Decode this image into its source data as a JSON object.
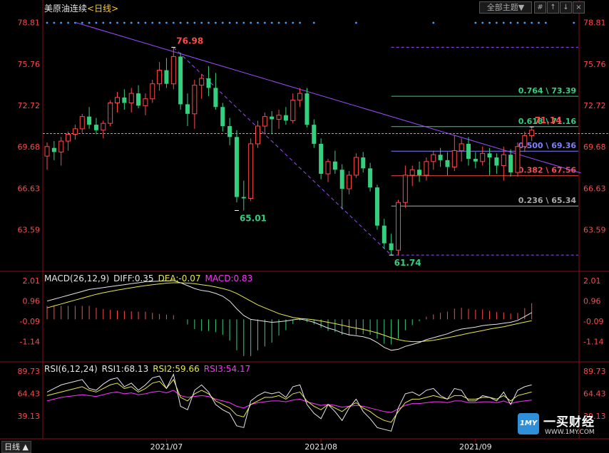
{
  "header": {
    "instrument": "美原油连续",
    "period_label": "<日线>",
    "theme_button": "全部主题▼",
    "tool_buttons": [
      "#",
      "↑",
      "↓",
      "×"
    ]
  },
  "period_tab": "日线 ▲",
  "macd_title": {
    "name": "MACD(26,12,9)",
    "diff": "DIFF:0.35",
    "dea": "DEA:-0.07",
    "macd": "MACD:0.83"
  },
  "rsi_title": {
    "name": "RSI(6,12,24)",
    "rsi1": "RSI1:68.13",
    "rsi2": "RSI2:59.66",
    "rsi3": "RSI3:54.17"
  },
  "logo": {
    "badge": "1MY",
    "name": "一买财经",
    "url": "WWW.1MY.COM"
  },
  "colors": {
    "up": "#ff4a4a",
    "down": "#35d07f",
    "trend_line": "#9b4dff",
    "diff_line": "#e6e6e6",
    "dea_line": "#e8e84a",
    "rsi3_line": "#ff33ff",
    "price_line": "#ff9900"
  },
  "chart_data": {
    "type": "candlestick",
    "y_ticks_main": [
      "78.81",
      "75.76",
      "72.72",
      "69.68",
      "66.63",
      "63.59"
    ],
    "y_range_main": [
      60.7,
      79.3
    ],
    "y_ticks_macd": [
      "2.01",
      "0.96",
      "-0.09",
      "-1.14"
    ],
    "y_range_macd": [
      -2.2,
      2.6
    ],
    "y_ticks_rsi": [
      "89.73",
      "64.43",
      "39.13"
    ],
    "y_range_rsi": [
      15,
      100
    ],
    "x_labels": [
      {
        "label": "2021/07",
        "index": 17
      },
      {
        "label": "2021/08",
        "index": 39
      },
      {
        "label": "2021/09",
        "index": 61
      }
    ],
    "current_price": 70.65,
    "annotations": [
      {
        "label": "76.98",
        "index": 18,
        "value": 76.98,
        "position": "above"
      },
      {
        "label": "65.01",
        "index": 27,
        "value": 65.01,
        "position": "below"
      },
      {
        "label": "61.74",
        "index": 49,
        "value": 61.74,
        "position": "below"
      },
      {
        "label": "71.14",
        "index": 69,
        "value": 71.14,
        "position": "above"
      }
    ],
    "fibonacci": {
      "start_index": 49,
      "levels": [
        {
          "label": "",
          "value": 76.98,
          "color": "#9b4dff",
          "dash": true
        },
        {
          "label": "0.764 \\ 73.39",
          "value": 73.39,
          "color": "#35d07f"
        },
        {
          "label": "0.618 \\ 71.16",
          "value": 71.16,
          "color": "#35d07f"
        },
        {
          "label": "0.500 \\ 69.36",
          "value": 69.36,
          "color": "#8080ff"
        },
        {
          "label": "0.382 \\ 67.56",
          "value": 67.56,
          "color": "#ff4a4a"
        },
        {
          "label": "0.236 \\ 65.34",
          "value": 65.34,
          "color": "#aaaaaa"
        },
        {
          "label": "",
          "value": 61.74,
          "color": "#9b4dff",
          "dash": true
        }
      ]
    },
    "trend_lines": [
      {
        "from": [
          4,
          78.81
        ],
        "to": [
          76,
          67.76
        ],
        "dash": false
      },
      {
        "from": [
          18,
          76.98
        ],
        "to": [
          49,
          61.74
        ],
        "dash": true
      }
    ],
    "dots_row": [
      0,
      1,
      2,
      3,
      4,
      5,
      6,
      7,
      8,
      9,
      10,
      11,
      12,
      13,
      14,
      15,
      16,
      17,
      18,
      19,
      20,
      21,
      22,
      23,
      24,
      25,
      26,
      27,
      28,
      29,
      30,
      31,
      32,
      33,
      34,
      35,
      36,
      38,
      44,
      55,
      61,
      62,
      63,
      64,
      65,
      66,
      67,
      68,
      69,
      70,
      71,
      75
    ],
    "candles": [
      {
        "o": 69.0,
        "h": 70.0,
        "l": 68.0,
        "c": 69.7
      },
      {
        "o": 69.6,
        "h": 70.1,
        "l": 68.7,
        "c": 69.3
      },
      {
        "o": 69.3,
        "h": 70.4,
        "l": 68.3,
        "c": 70.1
      },
      {
        "o": 70.1,
        "h": 70.8,
        "l": 69.4,
        "c": 70.6
      },
      {
        "o": 70.6,
        "h": 71.3,
        "l": 70.2,
        "c": 71.0
      },
      {
        "o": 71.0,
        "h": 72.1,
        "l": 70.7,
        "c": 71.9
      },
      {
        "o": 71.9,
        "h": 72.6,
        "l": 71.0,
        "c": 71.3
      },
      {
        "o": 71.3,
        "h": 71.8,
        "l": 70.6,
        "c": 70.9
      },
      {
        "o": 70.9,
        "h": 71.6,
        "l": 70.3,
        "c": 71.4
      },
      {
        "o": 71.4,
        "h": 73.1,
        "l": 71.2,
        "c": 72.9
      },
      {
        "o": 72.9,
        "h": 73.7,
        "l": 72.2,
        "c": 73.3
      },
      {
        "o": 73.3,
        "h": 73.9,
        "l": 72.4,
        "c": 72.9
      },
      {
        "o": 72.9,
        "h": 74.0,
        "l": 72.2,
        "c": 73.6
      },
      {
        "o": 73.6,
        "h": 74.2,
        "l": 72.5,
        "c": 72.7
      },
      {
        "o": 72.7,
        "h": 73.6,
        "l": 72.0,
        "c": 73.2
      },
      {
        "o": 73.2,
        "h": 74.6,
        "l": 72.9,
        "c": 74.3
      },
      {
        "o": 74.3,
        "h": 75.9,
        "l": 73.8,
        "c": 75.3
      },
      {
        "o": 75.3,
        "h": 76.2,
        "l": 74.0,
        "c": 74.3
      },
      {
        "o": 74.3,
        "h": 76.98,
        "l": 73.9,
        "c": 76.3
      },
      {
        "o": 76.3,
        "h": 76.6,
        "l": 72.4,
        "c": 72.8
      },
      {
        "o": 72.8,
        "h": 73.6,
        "l": 71.2,
        "c": 72.1
      },
      {
        "o": 72.1,
        "h": 74.6,
        "l": 71.0,
        "c": 74.2
      },
      {
        "o": 74.2,
        "h": 75.0,
        "l": 73.2,
        "c": 74.7
      },
      {
        "o": 74.7,
        "h": 75.6,
        "l": 73.4,
        "c": 74.0
      },
      {
        "o": 74.0,
        "h": 75.1,
        "l": 72.4,
        "c": 72.6
      },
      {
        "o": 72.6,
        "h": 72.9,
        "l": 70.8,
        "c": 71.2
      },
      {
        "o": 71.2,
        "h": 71.8,
        "l": 69.8,
        "c": 70.4
      },
      {
        "o": 70.4,
        "h": 70.9,
        "l": 65.6,
        "c": 66.0
      },
      {
        "o": 66.0,
        "h": 67.2,
        "l": 65.01,
        "c": 65.9
      },
      {
        "o": 65.9,
        "h": 70.3,
        "l": 65.7,
        "c": 69.9
      },
      {
        "o": 69.9,
        "h": 71.6,
        "l": 69.6,
        "c": 71.2
      },
      {
        "o": 71.2,
        "h": 72.2,
        "l": 70.6,
        "c": 71.9
      },
      {
        "o": 71.9,
        "h": 72.3,
        "l": 70.6,
        "c": 71.7
      },
      {
        "o": 71.7,
        "h": 72.4,
        "l": 71.0,
        "c": 72.0
      },
      {
        "o": 72.0,
        "h": 72.6,
        "l": 71.3,
        "c": 71.6
      },
      {
        "o": 71.6,
        "h": 73.6,
        "l": 71.4,
        "c": 73.1
      },
      {
        "o": 73.1,
        "h": 74.0,
        "l": 72.6,
        "c": 73.6
      },
      {
        "o": 73.6,
        "h": 74.0,
        "l": 71.1,
        "c": 71.3
      },
      {
        "o": 71.3,
        "h": 71.7,
        "l": 69.6,
        "c": 69.9
      },
      {
        "o": 69.9,
        "h": 70.3,
        "l": 67.3,
        "c": 67.7
      },
      {
        "o": 67.7,
        "h": 68.8,
        "l": 67.1,
        "c": 68.6
      },
      {
        "o": 68.6,
        "h": 69.4,
        "l": 67.7,
        "c": 68.0
      },
      {
        "o": 68.0,
        "h": 68.4,
        "l": 65.1,
        "c": 66.6
      },
      {
        "o": 66.6,
        "h": 67.9,
        "l": 66.2,
        "c": 67.6
      },
      {
        "o": 67.6,
        "h": 69.2,
        "l": 67.4,
        "c": 68.9
      },
      {
        "o": 68.9,
        "h": 69.3,
        "l": 67.8,
        "c": 68.1
      },
      {
        "o": 68.1,
        "h": 68.5,
        "l": 66.4,
        "c": 66.7
      },
      {
        "o": 66.7,
        "h": 66.9,
        "l": 63.6,
        "c": 63.9
      },
      {
        "o": 63.9,
        "h": 64.4,
        "l": 62.2,
        "c": 62.6
      },
      {
        "o": 62.6,
        "h": 63.3,
        "l": 61.74,
        "c": 62.1
      },
      {
        "o": 62.1,
        "h": 65.8,
        "l": 61.74,
        "c": 65.6
      },
      {
        "o": 65.6,
        "h": 68.3,
        "l": 65.2,
        "c": 67.6
      },
      {
        "o": 67.6,
        "h": 68.3,
        "l": 66.8,
        "c": 68.0
      },
      {
        "o": 68.0,
        "h": 68.6,
        "l": 67.1,
        "c": 67.6
      },
      {
        "o": 67.6,
        "h": 68.9,
        "l": 67.2,
        "c": 68.6
      },
      {
        "o": 68.6,
        "h": 69.4,
        "l": 68.0,
        "c": 69.1
      },
      {
        "o": 69.1,
        "h": 69.6,
        "l": 68.2,
        "c": 68.7
      },
      {
        "o": 68.7,
        "h": 69.3,
        "l": 67.6,
        "c": 68.2
      },
      {
        "o": 68.2,
        "h": 70.5,
        "l": 67.9,
        "c": 69.4
      },
      {
        "o": 69.4,
        "h": 70.3,
        "l": 68.6,
        "c": 69.9
      },
      {
        "o": 69.9,
        "h": 70.4,
        "l": 68.3,
        "c": 68.8
      },
      {
        "o": 68.8,
        "h": 69.3,
        "l": 68.1,
        "c": 68.6
      },
      {
        "o": 68.6,
        "h": 69.7,
        "l": 68.3,
        "c": 69.2
      },
      {
        "o": 69.2,
        "h": 69.6,
        "l": 67.6,
        "c": 68.9
      },
      {
        "o": 68.9,
        "h": 69.2,
        "l": 67.7,
        "c": 68.3
      },
      {
        "o": 68.3,
        "h": 69.7,
        "l": 67.2,
        "c": 69.1
      },
      {
        "o": 69.1,
        "h": 69.5,
        "l": 67.5,
        "c": 67.8
      },
      {
        "o": 67.8,
        "h": 70.0,
        "l": 67.5,
        "c": 69.7
      },
      {
        "o": 69.7,
        "h": 70.8,
        "l": 69.3,
        "c": 70.5
      },
      {
        "o": 70.5,
        "h": 71.14,
        "l": 70.1,
        "c": 70.9
      }
    ],
    "macd": {
      "diff": [
        0.95,
        1.05,
        1.15,
        1.25,
        1.35,
        1.45,
        1.55,
        1.6,
        1.65,
        1.7,
        1.75,
        1.8,
        1.85,
        1.9,
        1.95,
        1.97,
        1.98,
        2.0,
        2.01,
        1.9,
        1.75,
        1.6,
        1.5,
        1.45,
        1.35,
        1.2,
        0.95,
        0.55,
        0.2,
        0.0,
        -0.05,
        -0.1,
        -0.15,
        -0.12,
        -0.08,
        -0.02,
        0.02,
        -0.05,
        -0.15,
        -0.3,
        -0.45,
        -0.55,
        -0.7,
        -0.8,
        -0.85,
        -0.9,
        -1.0,
        -1.2,
        -1.45,
        -1.6,
        -1.55,
        -1.4,
        -1.3,
        -1.2,
        -1.05,
        -0.95,
        -0.85,
        -0.75,
        -0.6,
        -0.5,
        -0.45,
        -0.4,
        -0.32,
        -0.28,
        -0.25,
        -0.2,
        -0.15,
        -0.05,
        0.15,
        0.35
      ],
      "dea": [
        0.6,
        0.7,
        0.8,
        0.9,
        1.0,
        1.1,
        1.2,
        1.3,
        1.38,
        1.45,
        1.52,
        1.58,
        1.64,
        1.7,
        1.75,
        1.8,
        1.84,
        1.88,
        1.9,
        1.9,
        1.88,
        1.85,
        1.8,
        1.75,
        1.68,
        1.6,
        1.5,
        1.35,
        1.15,
        0.95,
        0.75,
        0.6,
        0.45,
        0.3,
        0.2,
        0.1,
        0.05,
        0.02,
        -0.02,
        -0.08,
        -0.15,
        -0.22,
        -0.3,
        -0.38,
        -0.45,
        -0.52,
        -0.6,
        -0.7,
        -0.82,
        -0.95,
        -1.05,
        -1.12,
        -1.15,
        -1.15,
        -1.12,
        -1.08,
        -1.02,
        -0.95,
        -0.88,
        -0.8,
        -0.72,
        -0.65,
        -0.58,
        -0.5,
        -0.44,
        -0.38,
        -0.3,
        -0.22,
        -0.14,
        -0.07
      ]
    },
    "rsi": {
      "rsi1": [
        66,
        70,
        74,
        76,
        78,
        80,
        70,
        68,
        75,
        80,
        82,
        72,
        76,
        68,
        74,
        82,
        84,
        70,
        86,
        50,
        46,
        68,
        74,
        66,
        52,
        46,
        42,
        28,
        26,
        56,
        62,
        66,
        64,
        66,
        60,
        72,
        74,
        52,
        42,
        36,
        52,
        44,
        34,
        48,
        58,
        44,
        36,
        26,
        24,
        22,
        48,
        64,
        66,
        62,
        68,
        70,
        62,
        58,
        70,
        68,
        56,
        56,
        62,
        60,
        56,
        66,
        52,
        68,
        72,
        74
      ],
      "rsi2": [
        62,
        64,
        66,
        68,
        70,
        72,
        68,
        66,
        70,
        74,
        76,
        70,
        72,
        66,
        70,
        76,
        78,
        70,
        80,
        60,
        56,
        64,
        68,
        64,
        56,
        52,
        48,
        40,
        38,
        52,
        56,
        60,
        60,
        62,
        58,
        64,
        66,
        56,
        50,
        46,
        52,
        48,
        44,
        50,
        54,
        48,
        44,
        38,
        34,
        32,
        44,
        54,
        58,
        58,
        60,
        62,
        60,
        58,
        62,
        62,
        58,
        58,
        60,
        60,
        58,
        62,
        56,
        62,
        64,
        66
      ],
      "rsi3": [
        56,
        58,
        60,
        61,
        62,
        63,
        62,
        61,
        63,
        65,
        66,
        64,
        65,
        63,
        64,
        66,
        67,
        65,
        68,
        62,
        60,
        61,
        62,
        61,
        58,
        56,
        54,
        50,
        48,
        52,
        54,
        55,
        56,
        56,
        55,
        57,
        58,
        55,
        53,
        51,
        52,
        51,
        49,
        50,
        51,
        50,
        48,
        46,
        44,
        43,
        47,
        51,
        53,
        53,
        54,
        55,
        55,
        54,
        56,
        56,
        54,
        54,
        55,
        55,
        54,
        56,
        53,
        55,
        56,
        57
      ]
    }
  }
}
